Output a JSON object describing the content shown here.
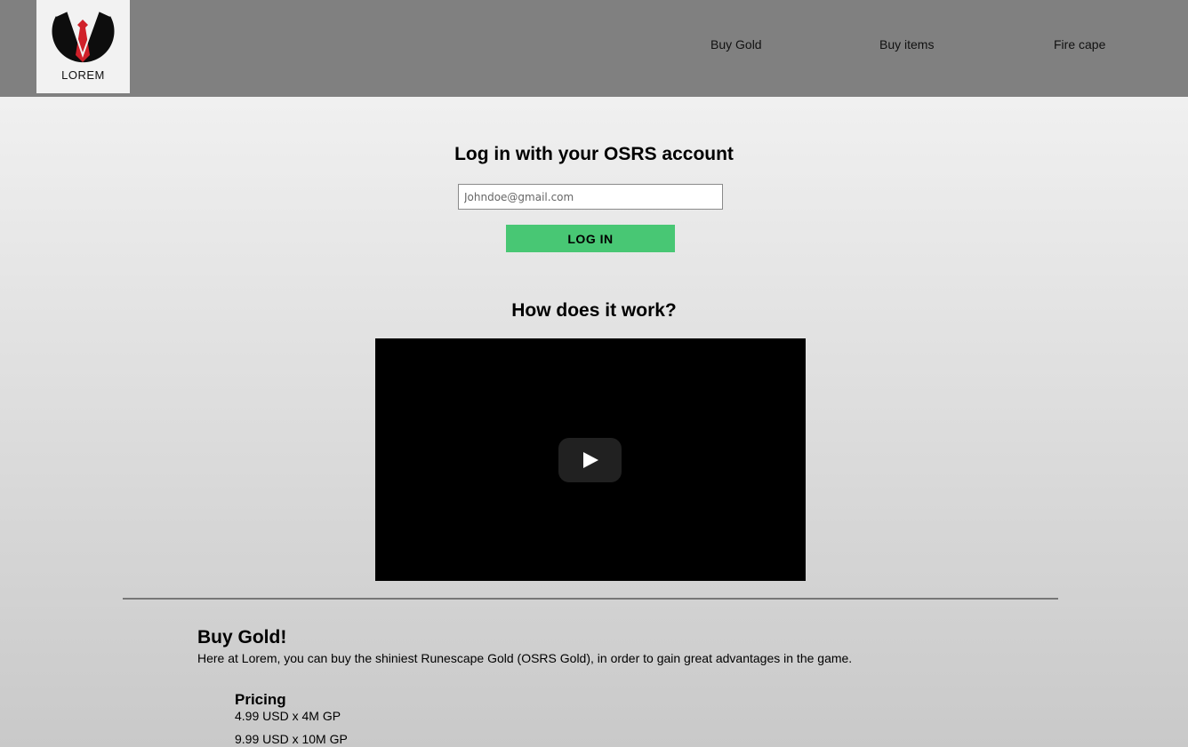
{
  "header": {
    "logo_text": "LOREM",
    "nav": [
      {
        "label": "Buy Gold"
      },
      {
        "label": "Buy items"
      },
      {
        "label": "Fire cape"
      }
    ]
  },
  "login": {
    "title": "Log in with your OSRS account",
    "email_placeholder": "Johndoe@gmail.com",
    "button_label": "LOG IN"
  },
  "how": {
    "title": "How does it work?"
  },
  "buy_gold": {
    "title": "Buy Gold!",
    "description": "Here at Lorem, you can buy the shiniest Runescape Gold (OSRS Gold), in order to gain great advantages in the game.",
    "pricing_title": "Pricing",
    "prices": [
      "4.99 USD x 4M GP",
      "9.99 USD x 10M GP"
    ]
  },
  "colors": {
    "header_bg": "#808080",
    "button_bg": "#48c774",
    "logo_red": "#d0202a"
  }
}
